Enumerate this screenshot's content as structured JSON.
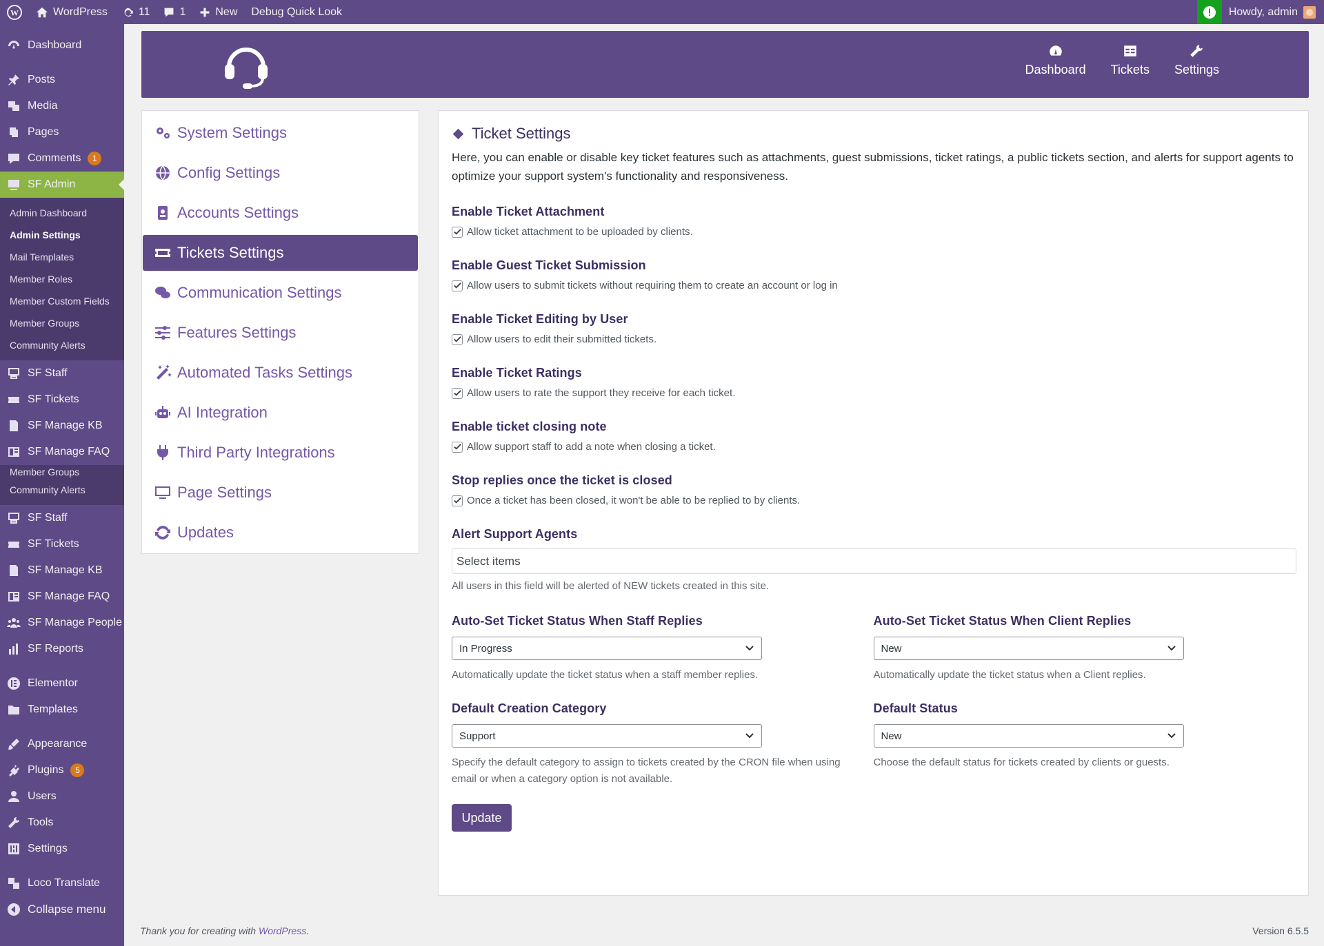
{
  "adminbar": {
    "site_name": "WordPress",
    "updates_count": "11",
    "comments_count": "1",
    "new_label": "New",
    "debug_label": "Debug Quick Look",
    "howdy": "Howdy, admin"
  },
  "sidebar": {
    "dashboard": "Dashboard",
    "posts": "Posts",
    "media": "Media",
    "pages": "Pages",
    "comments": "Comments",
    "comments_badge": "1",
    "sf_admin": "SF Admin",
    "sub1": [
      "Admin Dashboard",
      "Admin Settings",
      "Mail Templates",
      "Member Roles",
      "Member Custom Fields",
      "Member Groups",
      "Community Alerts"
    ],
    "sf_staff": "SF Staff",
    "sf_tickets": "SF Tickets",
    "sf_manage_kb": "SF Manage KB",
    "sf_manage_faq": "SF Manage FAQ",
    "sub2": [
      "Member Groups",
      "Community Alerts"
    ],
    "sf_manage_people": "SF Manage People",
    "sf_reports": "SF Reports",
    "elementor": "Elementor",
    "templates": "Templates",
    "appearance": "Appearance",
    "plugins": "Plugins",
    "plugins_badge": "5",
    "users": "Users",
    "tools": "Tools",
    "settings": "Settings",
    "loco": "Loco Translate",
    "collapse": "Collapse menu"
  },
  "header": {
    "nav": [
      "Dashboard",
      "Tickets",
      "Settings"
    ]
  },
  "settings_nav": [
    "System Settings",
    "Config Settings",
    "Accounts Settings",
    "Tickets Settings",
    "Communication Settings",
    "Features Settings",
    "Automated Tasks Settings",
    "AI Integration",
    "Third Party Integrations",
    "Page Settings",
    "Updates"
  ],
  "main": {
    "title": "Ticket Settings",
    "description": "Here, you can enable or disable key ticket features such as attachments, guest submissions, ticket ratings, a public tickets section, and alerts for support agents to optimize your support system's functionality and responsiveness.",
    "options": [
      {
        "label": "Enable Ticket Attachment",
        "text": "Allow ticket attachment to be uploaded by clients.",
        "checked": true
      },
      {
        "label": "Enable Guest Ticket Submission",
        "text": "Allow users to submit tickets without requiring them to create an account or log in",
        "checked": true
      },
      {
        "label": "Enable Ticket Editing by User",
        "text": "Allow users to edit their submitted tickets.",
        "checked": true
      },
      {
        "label": "Enable Ticket Ratings",
        "text": "Allow users to rate the support they receive for each ticket.",
        "checked": true
      },
      {
        "label": "Enable ticket closing note",
        "text": "Allow support staff to add a note when closing a ticket.",
        "checked": true
      },
      {
        "label": "Stop replies once the ticket is closed",
        "text": "Once a ticket has been closed, it won't be able to be replied to by clients.",
        "checked": true
      }
    ],
    "alert_label": "Alert Support Agents",
    "alert_placeholder": "Select items",
    "alert_help": "All users in this field will be alerted of NEW tickets created in this site.",
    "staff_status_label": "Auto-Set Ticket Status When Staff Replies",
    "staff_status_value": "In Progress",
    "staff_status_help": "Automatically update the ticket status when a staff member replies.",
    "client_status_label": "Auto-Set Ticket Status When Client Replies",
    "client_status_value": "New",
    "client_status_help": "Automatically update the ticket status when a Client replies.",
    "category_label": "Default Creation Category",
    "category_value": "Support",
    "category_help": "Specify the default category to assign to tickets created by the CRON file when using email or when a category option is not available.",
    "default_status_label": "Default Status",
    "default_status_value": "New",
    "default_status_help": "Choose the default status for tickets created by clients or guests.",
    "update_label": "Update"
  },
  "footer": {
    "thanks_prefix": "Thank you for creating with ",
    "thanks_link": "WordPress",
    "thanks_suffix": ".",
    "version": "Version 6.5.5"
  },
  "colors": {
    "brand_purple": "#5e4a86",
    "active_green": "#8db545",
    "link_purple": "#7558a8"
  }
}
